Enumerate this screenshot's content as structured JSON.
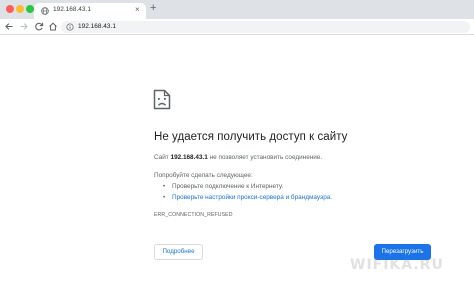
{
  "browser": {
    "tab": {
      "title": "192.168.43.1",
      "close_glyph": "×",
      "favicon": "globe-icon"
    },
    "new_tab_glyph": "+",
    "address_bar": {
      "url": "192.168.43.1",
      "icon": "info-icon"
    }
  },
  "error_page": {
    "icon": "sad-page-icon",
    "title": "Не удается получить доступ к сайту",
    "message": {
      "prefix": "Сайт ",
      "host": "192.168.43.1",
      "suffix": " не позволяет установить соединение."
    },
    "try_label": "Попробуйте сделать следующее:",
    "suggestions": [
      {
        "bullet": "•",
        "text": "Проверьте подключение к Интернету."
      },
      {
        "bullet": "•",
        "text": "Проверьте настройки прокси-сервера и брандмауэра."
      }
    ],
    "error_code": "ERR_CONNECTION_REFUSED",
    "details_button": "Подробнее",
    "reload_button": "Перезагрузить"
  },
  "watermark": "WIFIKA.RU",
  "colors": {
    "accent": "#1a73e8",
    "tabbar": "#dee1e6",
    "text_primary": "#202124",
    "text_secondary": "#5f6368"
  }
}
